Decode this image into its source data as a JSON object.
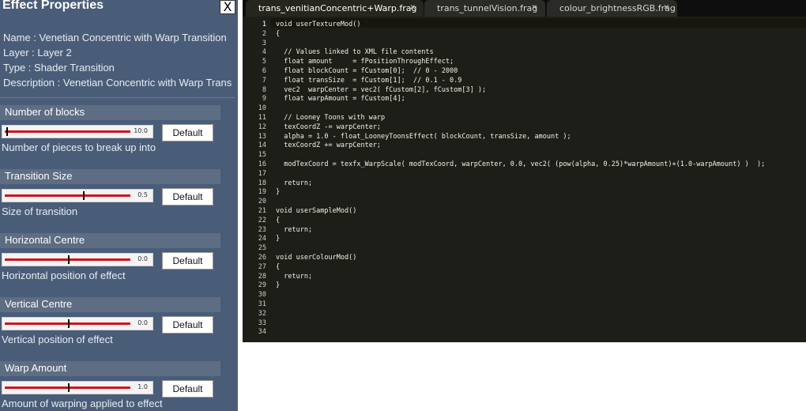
{
  "panel": {
    "title": "Effect Properties",
    "close_label": "X",
    "info": [
      "Name : Venetian Concentric with Warp Transition",
      "Layer : Layer 2",
      "Type : Shader Transition",
      "Description : Venetian Concentric with Warp Transition"
    ],
    "sections": [
      {
        "header": "Number of blocks",
        "value": "10.0",
        "level": 0.02,
        "button": "Default",
        "description": "Number of pieces to break up into"
      },
      {
        "header": "Transition Size",
        "value": "0.5",
        "level": 0.63,
        "button": "Default",
        "description": "Size of transition"
      },
      {
        "header": "Horizontal Centre",
        "value": "0.0",
        "level": 0.51,
        "button": "Default",
        "description": "Horizontal position of effect"
      },
      {
        "header": "Vertical Centre",
        "value": "0.0",
        "level": 0.51,
        "button": "Default",
        "description": "Vertical position of effect"
      },
      {
        "header": "Warp Amount",
        "value": "1.0",
        "level": 0.51,
        "button": "Default",
        "description": "Amount of warping applied to effect"
      }
    ]
  },
  "editor": {
    "tabs": [
      {
        "label": "trans_venitianConcentric+Warp.frag",
        "close": "✕",
        "active": true
      },
      {
        "label": "trans_tunnelVision.frag",
        "close": "✕",
        "active": false
      },
      {
        "label": "colour_brightnessRGB.frag",
        "close": "✕",
        "active": false
      }
    ],
    "current_line": 1,
    "lines": [
      "void userTextureMod()",
      "{",
      "",
      "  // Values linked to XML file contents",
      "  float amount     = fPositionThroughEffect;",
      "  float blockCount = fCustom[0];  // 0 - 2000",
      "  float transSize  = fCustom[1];  // 0.1 - 0.9",
      "  vec2  warpCenter = vec2( fCustom[2], fCustom[3] );",
      "  float warpAmount = fCustom[4];",
      "",
      "  // Looney Toons with warp",
      "  texCoordZ -= warpCenter;",
      "  alpha = 1.0 - float_LooneyToonsEffect( blockCount, transSize, amount );",
      "  texCoordZ += warpCenter;",
      "",
      "  modTexCoord = texfx_WarpScale( modTexCoord, warpCenter, 0.0, vec2( (pow(alpha, 0.25)*warpAmount)+(1.0-warpAmount) )  );",
      "",
      "  return;",
      "}",
      "",
      "void userSampleMod()",
      "{",
      "  return;",
      "}",
      "",
      "void userColourMod()",
      "{",
      "  return;",
      "}",
      "",
      "",
      "",
      "",
      ""
    ]
  }
}
